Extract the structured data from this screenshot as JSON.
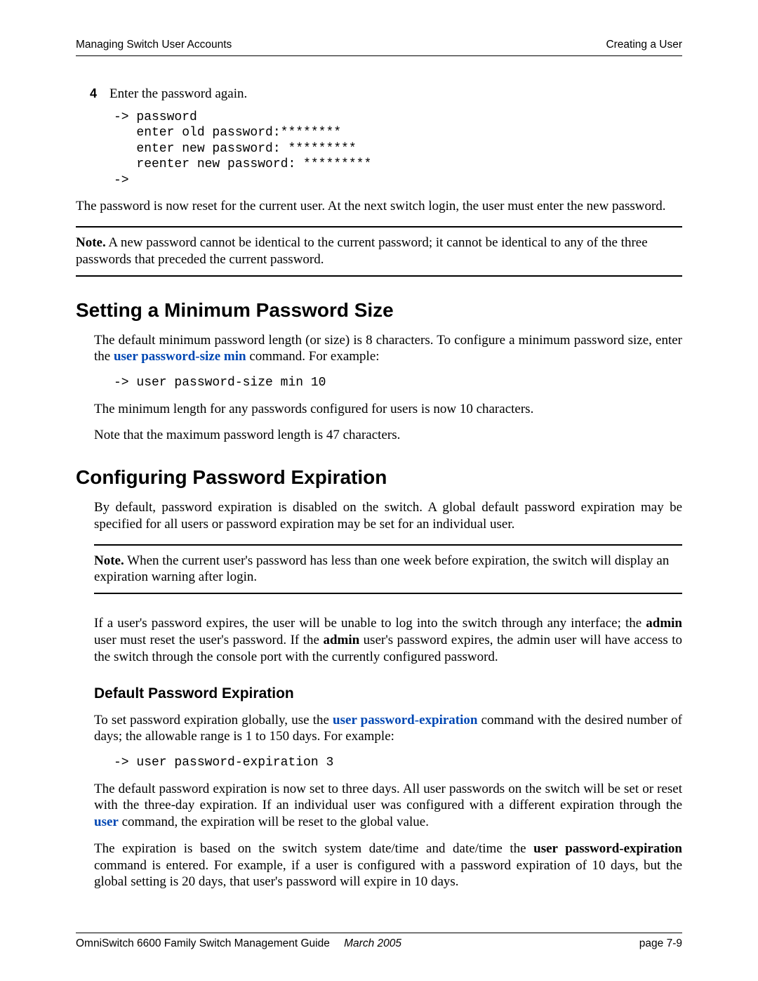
{
  "header": {
    "left": "Managing Switch User Accounts",
    "right": "Creating a User"
  },
  "step4": {
    "num": "4",
    "text": "Enter the password again."
  },
  "code1": "-> password\n   enter old password:********\n   enter new password: *********\n   reenter new password: *********\n->",
  "para_reset": "The password is now reset for the current user. At the next switch login, the user must enter the new pass­word.",
  "note1_prefix": "Note.",
  "note1_text": " A new password cannot be identical to the current password; it cannot be identical to any of the three passwords that preceded the current password.",
  "h2_min": "Setting a Minimum Password Size",
  "min_p1_a": "The default minimum password length (or size) is 8 characters. To configure a minimum password size, enter the ",
  "min_cmd": "user password-size min",
  "min_p1_b": " command. For example:",
  "code2": "-> user password-size min 10",
  "min_p2": "The minimum length for any passwords configured for users is now 10 characters.",
  "min_p3": "Note that the maximum password length is 47 characters.",
  "h2_exp": "Configuring Password Expiration",
  "exp_p1": "By default, password expiration is disabled on the switch. A global default password expiration may be specified for all users or password expiration may be set for an individual user.",
  "note2_prefix": "Note.",
  "note2_text": " When the current user's password has less than one week before expiration, the switch will display an expiration warning after login.",
  "exp_p2_a": "If a user's password expires, the user will be unable to log into the switch through any interface; the ",
  "exp_admin1": "admin",
  "exp_p2_b": " user must reset the user's password. If the ",
  "exp_admin2": "admin",
  "exp_p2_c": " user's password expires, the admin user will have access to the switch through the console port with the currently configured password.",
  "h3_default": "Default Password Expiration",
  "def_p1_a": "To set password expiration globally, use the ",
  "def_cmd": "user password-expiration",
  "def_p1_b": " command with the desired number of days; the allowable range is 1 to 150 days. For example:",
  "code3": "-> user password-expiration 3",
  "def_p2_a": "The default password expiration is now set to three days. All user passwords on the switch will be set or reset with the three-day expiration. If an individual user was configured with a different expiration through the ",
  "def_user_cmd": "user",
  "def_p2_b": " command, the expiration will be reset to the global value.",
  "def_p3_a": "The expiration is based on the switch system date/time and date/time the ",
  "def_bold": "user password-expiration",
  "def_p3_b": " command is entered. For example, if a user is configured with a password expiration of 10 days, but the global setting is 20 days, that user's password will expire in 10 days.",
  "footer": {
    "title": "OmniSwitch 6600 Family Switch Management Guide",
    "date": "March 2005",
    "page": "page 7-9"
  }
}
